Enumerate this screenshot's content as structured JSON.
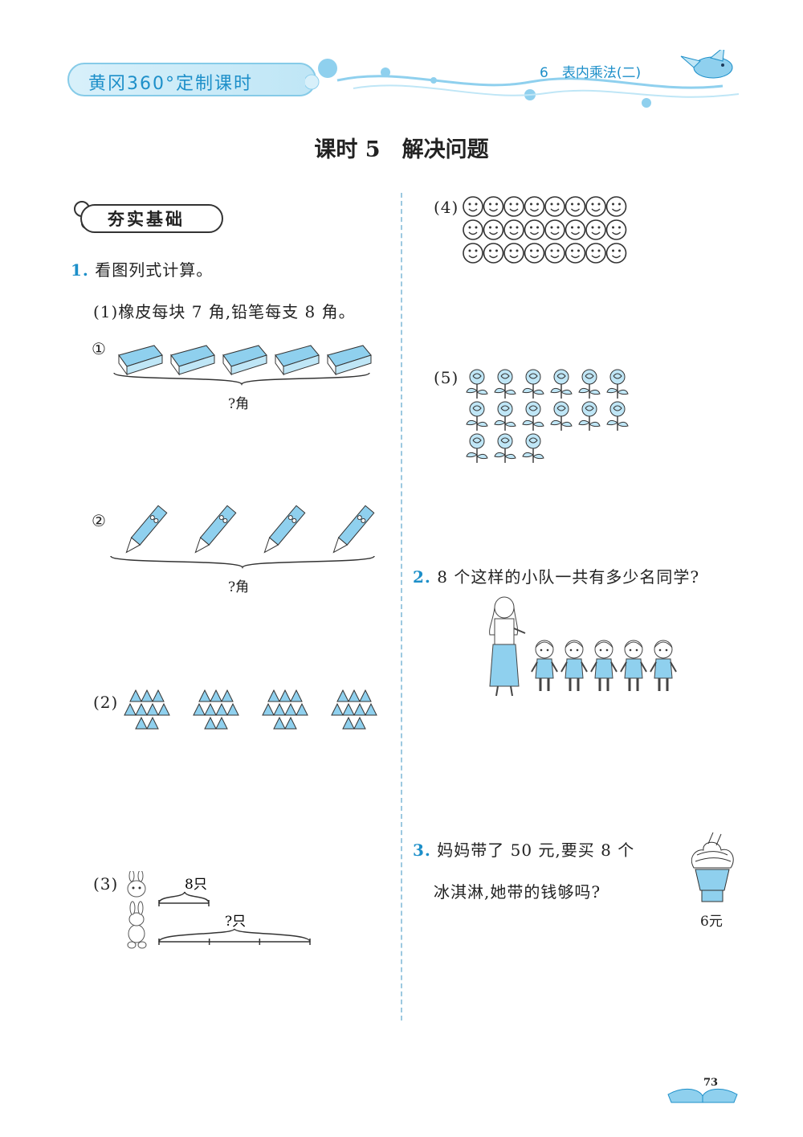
{
  "header": {
    "brand": "黄冈360°定制课时",
    "chapter": "6　表内乘法(二)"
  },
  "lesson_title": "课时 5　解决问题",
  "section": "夯实基础",
  "q1": {
    "number": "1.",
    "prompt": "看图列式计算。",
    "sub1": {
      "label": "(1)",
      "text": "橡皮每块 7 角,铅笔每支 8 角。",
      "part1": {
        "label": "①",
        "count": 5,
        "brace_label": "?角"
      },
      "part2": {
        "label": "②",
        "count": 4,
        "brace_label": "?角"
      }
    },
    "sub2": {
      "label": "(2)",
      "groups": 4,
      "rows_per_group": [
        3,
        4,
        2
      ]
    },
    "sub3": {
      "label": "(3)",
      "top_label": "8只",
      "bottom_label": "?只",
      "bottom_segments": 3
    },
    "sub4": {
      "label": "(4)",
      "rows": 3,
      "per_row": 8
    },
    "sub5": {
      "label": "(5)",
      "rows": [
        6,
        6,
        3
      ]
    }
  },
  "q2": {
    "number": "2.",
    "text": "8 个这样的小队一共有多少名同学?",
    "children": 5
  },
  "q3": {
    "number": "3.",
    "line1": "妈妈带了 50 元,要买 8 个",
    "line2": "冰淇淋,她带的钱够吗?",
    "price": "6元"
  },
  "page_number": "73",
  "colors": {
    "accent": "#1d8fc9",
    "fill": "#8fd0ee",
    "light": "#d8f0fa"
  }
}
